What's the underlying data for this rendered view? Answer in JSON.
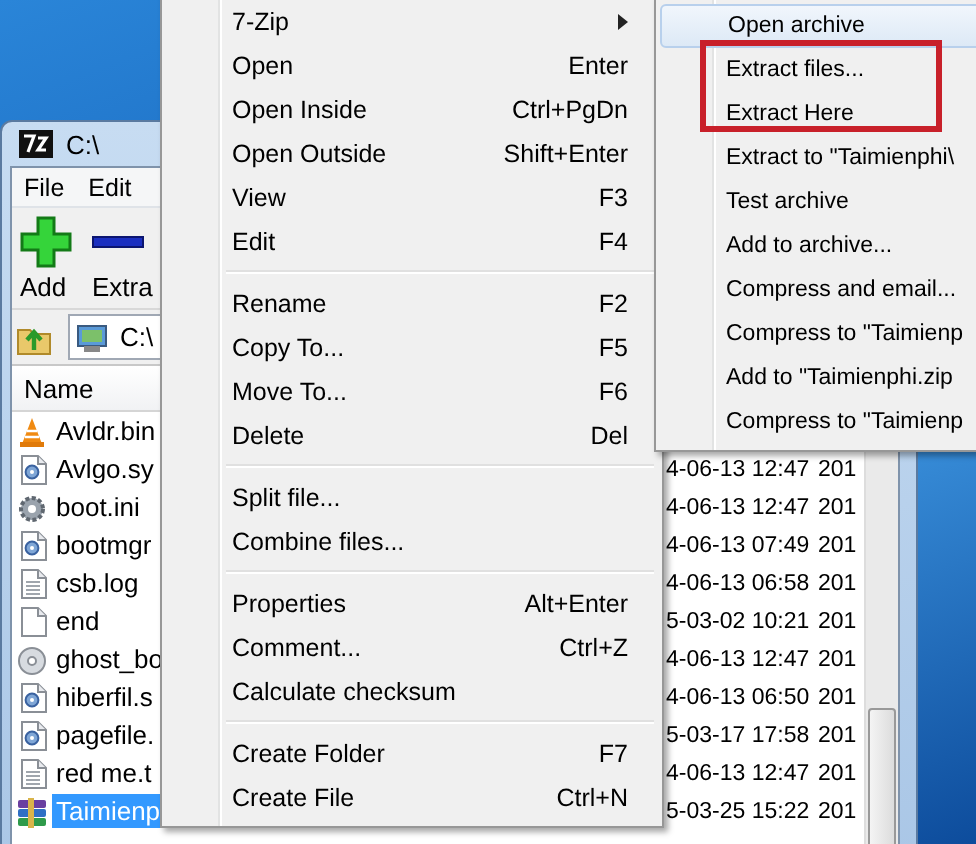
{
  "window": {
    "title": "C:\\",
    "menu_bar": [
      "File",
      "Edit"
    ],
    "toolbar": [
      {
        "label": "Add",
        "kind": "add"
      },
      {
        "label": "Extra",
        "kind": "extract"
      }
    ],
    "address": "C:\\",
    "columns": [
      "Name"
    ],
    "rows": [
      {
        "name": "Avldr.bin",
        "kind": "media",
        "selected": false
      },
      {
        "name": "Avlgo.sy",
        "kind": "system",
        "modified": "4-06-13 12:47",
        "column_3": "201",
        "selected": false
      },
      {
        "name": "boot.ini",
        "kind": "settings",
        "modified": "4-06-13 12:47",
        "column_3": "201",
        "selected": false
      },
      {
        "name": "bootmgr",
        "kind": "system",
        "modified": "4-06-13 07:49",
        "column_3": "201",
        "selected": false
      },
      {
        "name": "csb.log",
        "kind": "text",
        "modified": "4-06-13 06:58",
        "column_3": "201",
        "selected": false
      },
      {
        "name": "end",
        "kind": "blank",
        "modified": "5-03-02 10:21",
        "column_3": "201",
        "selected": false
      },
      {
        "name": "ghost_bo",
        "kind": "disk",
        "modified": "4-06-13 12:47",
        "column_3": "201",
        "selected": false
      },
      {
        "name": "hiberfil.s",
        "kind": "system",
        "modified": "4-06-13 06:50",
        "column_3": "201",
        "selected": false
      },
      {
        "name": "pagefile.",
        "kind": "system",
        "modified": "5-03-17 17:58",
        "column_3": "201",
        "selected": false
      },
      {
        "name": "red me.t",
        "kind": "text",
        "modified": "4-06-13 12:47",
        "column_3": "201",
        "selected": false
      },
      {
        "name": "Taimienp",
        "kind": "archive",
        "modified": "5-03-25 15:22",
        "column_3": "201",
        "selected": true
      }
    ]
  },
  "context_menu": [
    {
      "kind": "item",
      "label": "7-Zip",
      "submenu": true
    },
    {
      "kind": "item",
      "label": "Open",
      "shortcut": "Enter"
    },
    {
      "kind": "item",
      "label": "Open Inside",
      "shortcut": "Ctrl+PgDn"
    },
    {
      "kind": "item",
      "label": "Open Outside",
      "shortcut": "Shift+Enter"
    },
    {
      "kind": "item",
      "label": "View",
      "shortcut": "F3"
    },
    {
      "kind": "item",
      "label": "Edit",
      "shortcut": "F4"
    },
    {
      "kind": "separator"
    },
    {
      "kind": "item",
      "label": "Rename",
      "shortcut": "F2"
    },
    {
      "kind": "item",
      "label": "Copy To...",
      "shortcut": "F5"
    },
    {
      "kind": "item",
      "label": "Move To...",
      "shortcut": "F6"
    },
    {
      "kind": "item",
      "label": "Delete",
      "shortcut": "Del"
    },
    {
      "kind": "separator"
    },
    {
      "kind": "item",
      "label": "Split file..."
    },
    {
      "kind": "item",
      "label": "Combine files..."
    },
    {
      "kind": "separator"
    },
    {
      "kind": "item",
      "label": "Properties",
      "shortcut": "Alt+Enter"
    },
    {
      "kind": "item",
      "label": "Comment...",
      "shortcut": "Ctrl+Z"
    },
    {
      "kind": "item",
      "label": "Calculate checksum"
    },
    {
      "kind": "separator"
    },
    {
      "kind": "item",
      "label": "Create Folder",
      "shortcut": "F7"
    },
    {
      "kind": "item",
      "label": "Create File",
      "shortcut": "Ctrl+N"
    }
  ],
  "submenu": [
    {
      "label": "Open archive",
      "selected": true,
      "boxed": false
    },
    {
      "label": "Extract files...",
      "selected": false,
      "boxed": true
    },
    {
      "label": "Extract Here",
      "selected": false,
      "boxed": true
    },
    {
      "label": "Extract to \"Taimienphi\\",
      "selected": false,
      "boxed": false
    },
    {
      "label": "Test archive",
      "selected": false,
      "boxed": false
    },
    {
      "label": "Add to archive...",
      "selected": false,
      "boxed": false
    },
    {
      "label": "Compress and email...",
      "selected": false,
      "boxed": false
    },
    {
      "label": "Compress to \"Taimienp",
      "selected": false,
      "boxed": false
    },
    {
      "label": "Add to \"Taimienphi.zip",
      "selected": false,
      "boxed": false
    },
    {
      "label": "Compress to \"Taimienp",
      "selected": false,
      "boxed": false
    }
  ]
}
